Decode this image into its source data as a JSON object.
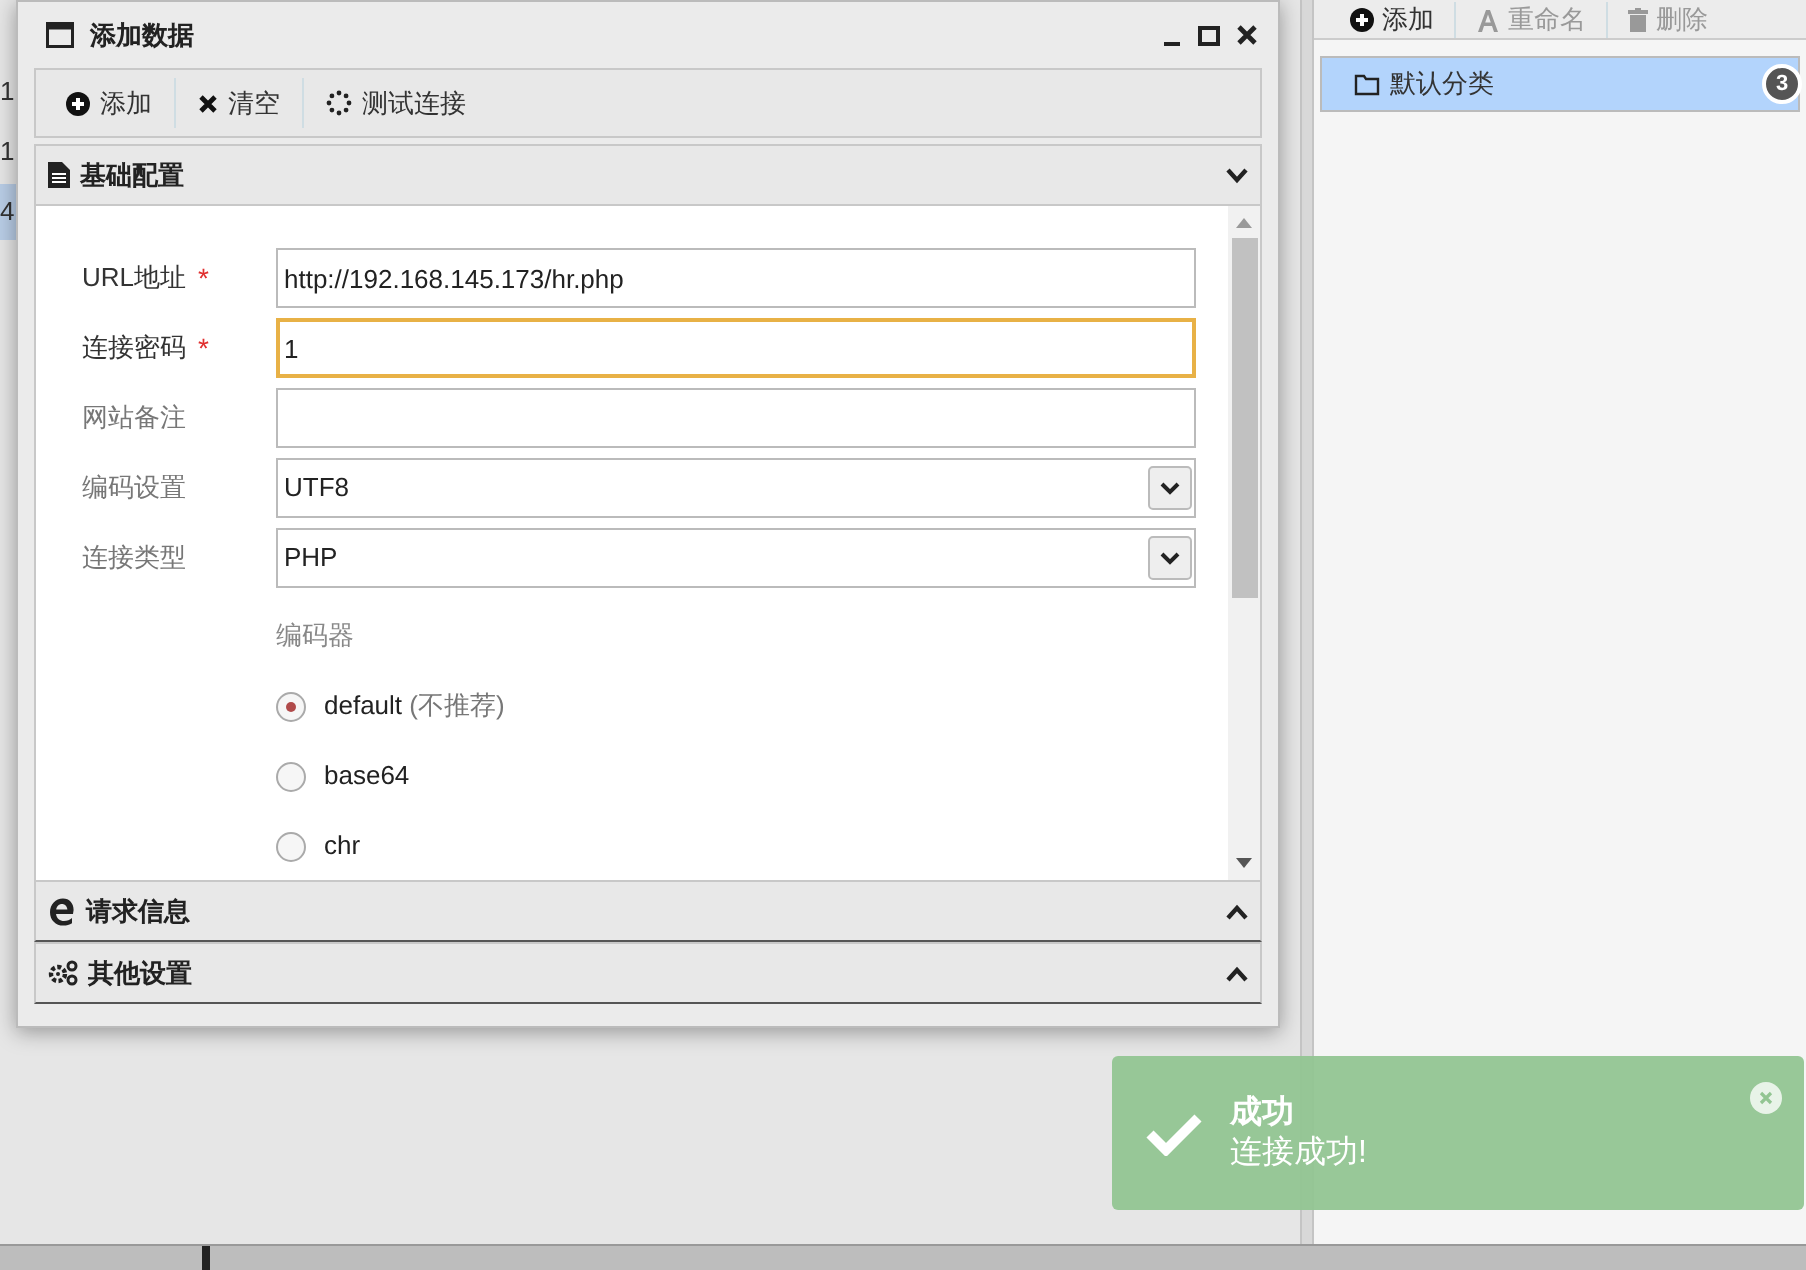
{
  "background": {
    "column_cells": [
      "1",
      "1",
      "4"
    ]
  },
  "dialog": {
    "title": "添加数据",
    "toolbar": [
      {
        "label": "添加"
      },
      {
        "label": "清空"
      },
      {
        "label": "测试连接"
      }
    ],
    "sections": [
      {
        "title": "基础配置",
        "expanded": true
      },
      {
        "title": "请求信息",
        "expanded": false
      },
      {
        "title": "其他设置",
        "expanded": false
      }
    ],
    "form": {
      "fields": [
        {
          "label": "URL地址",
          "required_mark": "*",
          "kind": "text",
          "value": "http://192.168.145.173/hr.php",
          "focused": false
        },
        {
          "label": "连接密码",
          "required_mark": "*",
          "kind": "text",
          "value": "1",
          "focused": true
        },
        {
          "label": "网站备注",
          "kind": "text",
          "focused": false
        },
        {
          "label": "编码设置",
          "kind": "select",
          "value": "UTF8",
          "focused": false
        },
        {
          "label": "连接类型",
          "kind": "select",
          "value": "PHP",
          "focused": false
        }
      ],
      "encoder": {
        "label": "编码器",
        "options": [
          {
            "label": "default",
            "note": "(不推荐)",
            "selected": true
          },
          {
            "label": "base64",
            "selected": false
          },
          {
            "label": "chr",
            "selected": false
          }
        ]
      }
    }
  },
  "side_panel": {
    "toolbar": [
      {
        "label": "添加",
        "disabled": false
      },
      {
        "label": "重命名",
        "disabled": true
      },
      {
        "label": "删除",
        "disabled": true
      }
    ],
    "categories": [
      {
        "label": "默认分类",
        "count": "3",
        "selected": true
      }
    ]
  },
  "toast": {
    "title": "成功",
    "message": "连接成功!"
  }
}
